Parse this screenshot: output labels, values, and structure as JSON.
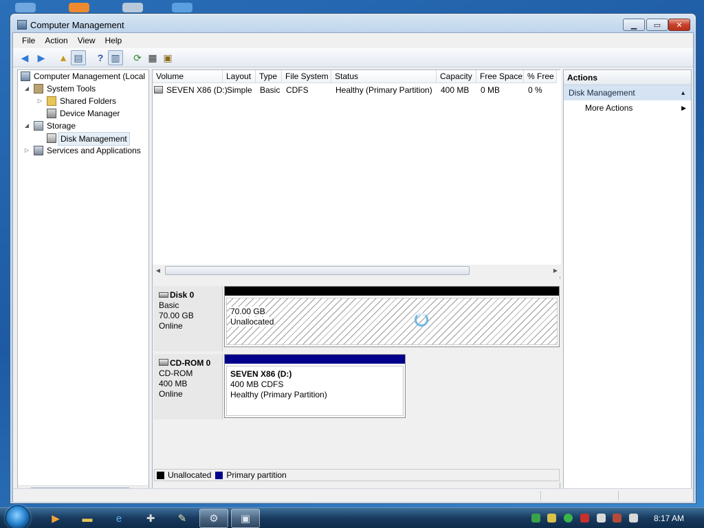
{
  "window": {
    "title": "Computer Management"
  },
  "menu": [
    "File",
    "Action",
    "View",
    "Help"
  ],
  "tree": {
    "root": "Computer Management (Local",
    "system_tools": "System Tools",
    "shared_folders": "Shared Folders",
    "device_manager": "Device Manager",
    "storage": "Storage",
    "disk_management": "Disk Management",
    "services_apps": "Services and Applications"
  },
  "volume_list": {
    "columns": [
      "Volume",
      "Layout",
      "Type",
      "File System",
      "Status",
      "Capacity",
      "Free Space",
      "% Free"
    ],
    "rows": [
      {
        "volume": "SEVEN X86 (D:)",
        "layout": "Simple",
        "type": "Basic",
        "file_system": "CDFS",
        "status": "Healthy (Primary Partition)",
        "capacity": "400 MB",
        "free_space": "0 MB",
        "pct_free": "0 %"
      }
    ]
  },
  "disks": [
    {
      "name": "Disk 0",
      "type": "Basic",
      "size": "70.00 GB",
      "state": "Online",
      "partition": {
        "size": "70.00 GB",
        "label": "Unallocated"
      }
    },
    {
      "name": "CD-ROM 0",
      "type": "CD-ROM",
      "size": "400 MB",
      "state": "Online",
      "partition": {
        "title": "SEVEN X86  (D:)",
        "detail": "400 MB CDFS",
        "status": "Healthy (Primary Partition)"
      }
    }
  ],
  "legend": {
    "unallocated": "Unallocated",
    "primary": "Primary partition"
  },
  "actions": {
    "header": "Actions",
    "section": "Disk Management",
    "more": "More Actions"
  },
  "taskbar": {
    "clock": "8:17 AM"
  },
  "colors": {
    "unallocated_bar": "#000000",
    "primary_bar": "#00008b",
    "selection": "#d5e3f2"
  },
  "icons": [
    "back-icon",
    "forward-icon",
    "up-icon",
    "show-hide-tree-icon",
    "help-icon",
    "show-hide-action-icon",
    "refresh-icon",
    "properties-icon",
    "export-icon"
  ]
}
